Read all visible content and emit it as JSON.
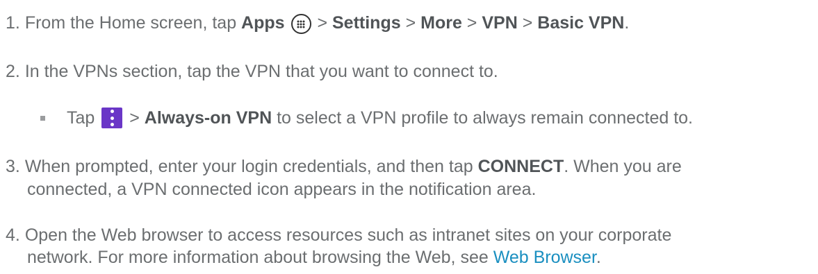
{
  "steps": [
    {
      "number": "1.",
      "parts": {
        "a": "From the Home screen, tap ",
        "apps": "Apps",
        "sep1": " > ",
        "settings": "Settings",
        "sep2": " > ",
        "more": "More",
        "sep3": " > ",
        "vpn": "VPN",
        "sep4": " > ",
        "basic_vpn": "Basic VPN",
        "end": "."
      }
    },
    {
      "number": "2.",
      "text": "In the VPNs section, tap the VPN that you want to connect to."
    },
    {
      "number": "3.",
      "line1_a": "When prompted, enter your login credentials, and then tap ",
      "connect": "CONNECT",
      "line1_b": ". When you are",
      "line2": "connected, a VPN connected icon appears in the notification area."
    },
    {
      "number": "4.",
      "line1": "Open the Web browser to access resources such as intranet sites on your corporate",
      "line2_a": "network. For more information about browsing the Web, see ",
      "link": "Web Browser",
      "line2_b": "."
    }
  ],
  "sub_bullet": {
    "tap": "Tap",
    "sep": " > ",
    "always_on": "Always-on VPN",
    "rest": " to select a VPN profile to always remain connected to."
  },
  "icons": {
    "apps_icon": "apps-grid-icon",
    "menu_icon": "more-options-icon",
    "menu_icon_color": "#6a36c7",
    "link_color": "#1a8fc0"
  }
}
